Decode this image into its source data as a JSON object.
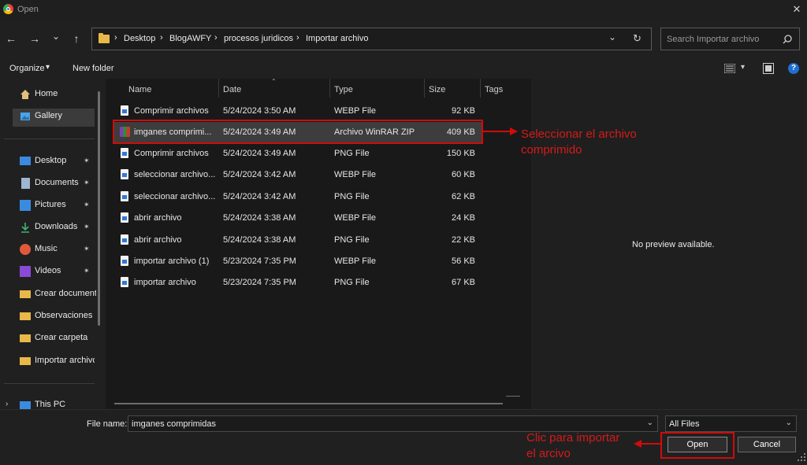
{
  "window": {
    "title": "Open",
    "close_icon": "close-icon"
  },
  "nav": {
    "back": "←",
    "forward": "→",
    "recent": "⌄",
    "up": "↑",
    "breadcrumbs": [
      "Desktop",
      "BlogAWFY",
      "procesos juridicos",
      "Importar archivo"
    ],
    "refresh": "↻",
    "address_dropdown": "⌄"
  },
  "search": {
    "placeholder": "Search Importar archivo"
  },
  "toolbar": {
    "organize_label": "Organize",
    "organize_arrow": "▾",
    "new_folder_label": "New folder",
    "help": "?"
  },
  "sidebar": {
    "top": [
      {
        "label": "Home",
        "icon": "home-icon"
      },
      {
        "label": "Gallery",
        "icon": "gallery-icon"
      }
    ],
    "quick": [
      {
        "label": "Desktop",
        "icon": "desktop-icon",
        "pinned": true
      },
      {
        "label": "Documents",
        "icon": "documents-icon",
        "pinned": true
      },
      {
        "label": "Pictures",
        "icon": "pictures-icon",
        "pinned": true
      },
      {
        "label": "Downloads",
        "icon": "downloads-icon",
        "pinned": true
      },
      {
        "label": "Music",
        "icon": "music-icon",
        "pinned": true
      },
      {
        "label": "Videos",
        "icon": "videos-icon",
        "pinned": true
      },
      {
        "label": "Crear document",
        "icon": "folder-icon",
        "pinned": false
      },
      {
        "label": "Observaciones",
        "icon": "folder-icon",
        "pinned": false
      },
      {
        "label": "Crear carpeta",
        "icon": "folder-icon",
        "pinned": false
      },
      {
        "label": "Importar archivo",
        "icon": "folder-icon",
        "pinned": false
      }
    ],
    "this_pc": "This PC",
    "pin_glyph": "📌"
  },
  "columns": {
    "name": "Name",
    "date": "Date",
    "type": "Type",
    "size": "Size",
    "tags": "Tags"
  },
  "files": [
    {
      "name": "Comprimir archivos",
      "date": "5/24/2024 3:50 AM",
      "type": "WEBP File",
      "size": "92 KB"
    },
    {
      "name": "imganes comprimi...",
      "date": "5/24/2024 3:49 AM",
      "type": "Archivo WinRAR ZIP",
      "size": "409 KB"
    },
    {
      "name": "Comprimir archivos",
      "date": "5/24/2024 3:49 AM",
      "type": "PNG File",
      "size": "150 KB"
    },
    {
      "name": "seleccionar archivo...",
      "date": "5/24/2024 3:42 AM",
      "type": "WEBP File",
      "size": "60 KB"
    },
    {
      "name": "seleccionar archivo...",
      "date": "5/24/2024 3:42 AM",
      "type": "PNG File",
      "size": "62 KB"
    },
    {
      "name": "abrir archivo",
      "date": "5/24/2024 3:38 AM",
      "type": "WEBP File",
      "size": "24 KB"
    },
    {
      "name": "abrir archivo",
      "date": "5/24/2024 3:38 AM",
      "type": "PNG File",
      "size": "22 KB"
    },
    {
      "name": "importar archivo (1)",
      "date": "5/23/2024 7:35 PM",
      "type": "WEBP File",
      "size": "56 KB"
    },
    {
      "name": "importar archivo",
      "date": "5/23/2024 7:35 PM",
      "type": "PNG File",
      "size": "67 KB"
    }
  ],
  "preview": {
    "text": "No preview available."
  },
  "bottom": {
    "filename_label": "File name:",
    "filename_value": "imganes comprimidas",
    "filetype_value": "All Files",
    "open_label": "Open",
    "cancel_label": "Cancel"
  },
  "annotations": {
    "select_line1": "Seleccionar el archivo",
    "select_line2": "comprimido",
    "click_line1": "Clic para importar",
    "click_line2": "el arcivo",
    "color": "#d10b0b"
  }
}
